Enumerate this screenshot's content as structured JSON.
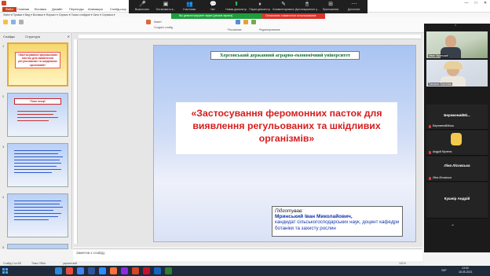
{
  "window": {
    "title": "Презентация1 - PowerPoint",
    "controls": [
      "—",
      "□",
      "✕"
    ]
  },
  "ribbon_tabs": [
    "Файл",
    "Главная",
    "Вставка",
    "Дизайн",
    "Переходы",
    "Анимация",
    "Слайд-шоу",
    "Рецензирование",
    "Вид"
  ],
  "menubar": "Файл ▾  Правка ▾  Вид ▾  Вставка ▾  Формат ▾  Сервис ▾  Показ слайдов ▾  Окно ▾  Справка ▾",
  "toolbar": {
    "layout_label": "Макет",
    "create_label": "Создать слайд",
    "theme_label": "Темы",
    "drawing_label": "Рисование",
    "editing_label": "Редактирование"
  },
  "zoom": {
    "items": [
      {
        "icon": "mic-icon",
        "glyph": "🎤",
        "label": "Выключить"
      },
      {
        "icon": "video-icon",
        "glyph": "▣",
        "label": "Остановить в..."
      },
      {
        "icon": "participants-icon",
        "glyph": "👥",
        "label": "Участники"
      },
      {
        "icon": "chat-icon",
        "glyph": "💬",
        "label": "Чат"
      },
      {
        "icon": "share-icon",
        "glyph": "⬆",
        "label": "Новая демонстр."
      },
      {
        "icon": "pause-icon",
        "glyph": "⏸",
        "label": "Пауза демонстр."
      },
      {
        "icon": "annotate-icon",
        "glyph": "✎",
        "label": "Комментировать"
      },
      {
        "icon": "remote-icon",
        "glyph": "🖱",
        "label": "Дистанционное у..."
      },
      {
        "icon": "apps-icon",
        "glyph": "⊞",
        "label": "Приложения"
      },
      {
        "icon": "more-icon",
        "glyph": "⋯",
        "label": "Дополнит."
      }
    ],
    "sharing_status": "Вы демонстрируете экран (режим экрана)",
    "stop_label": "Остановить совместное использование"
  },
  "slide_panel": {
    "tab_slides": "Слайды",
    "tab_outline": "Структура",
    "close": "✕",
    "thumbs": [
      {
        "num": "1",
        "title": "«Застосування феромонних пасток для виявлення регульованих та шкідливих організмів»"
      },
      {
        "num": "2",
        "title": "План лекції"
      },
      {
        "num": "3",
        "title": ""
      },
      {
        "num": "4",
        "title": ""
      },
      {
        "num": "5",
        "title": ""
      }
    ]
  },
  "slide": {
    "university": "Херсонський державний аграрно-економічний університет",
    "title": "«Застосування феромонних пасток для виявлення регульованих та шкідливих організмів»",
    "prepared_label": "Підготував:",
    "author": "Мринський Іван Миколайович,",
    "author_desc": "кандидат сільськогосподарських наук, доцент кафедри ботаніки та захисту рослин"
  },
  "notes": {
    "placeholder": "Заметки к слайду"
  },
  "status": {
    "slide": "Слайд 1 из 65",
    "theme": "Тема Office",
    "lang": "украинский",
    "zoom": "101%"
  },
  "participants": {
    "videos": [
      {
        "name": "Иван Мринский"
      },
      {
        "name": "Татьяна Толстова"
      }
    ],
    "tiles": [
      {
        "big": "БереженийМі...",
        "small": "БереженийМіша"
      },
      {
        "big": "",
        "small": "Андрій Мулено"
      },
      {
        "big": "Ліна Лісовська",
        "small": "Ліна Лісовська"
      },
      {
        "big": "Кушнір Андрій",
        "small": ""
      }
    ]
  },
  "taskbar": {
    "time": "13:00",
    "date": "18.05.2021",
    "lang": "УКР"
  },
  "colors": {
    "title_red": "#d61d1d",
    "university_green": "#0a6b2a",
    "author_blue": "#1133aa",
    "zoom_green": "#1f9d3e",
    "zoom_red": "#d9352b"
  }
}
